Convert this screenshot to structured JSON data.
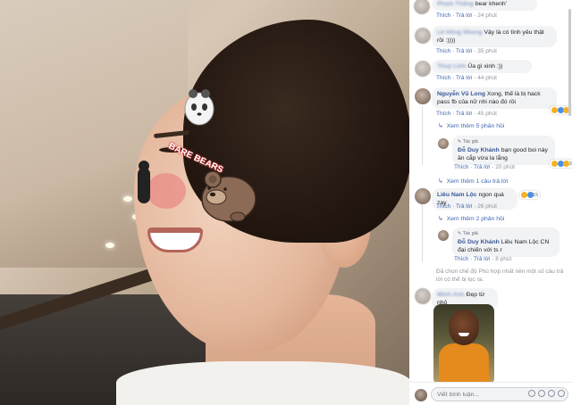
{
  "comments": [
    {
      "name": "Phạm Thắng",
      "text": "bear khenh'",
      "action_like": "Thích",
      "action_reply": "Trả lời",
      "time": "24 phút"
    },
    {
      "name": "Lê Hồng Nhung",
      "text": "Vậy là có tình yêu thật rồi :))))",
      "action_like": "Thích",
      "action_reply": "Trả lời",
      "time": "35 phút"
    },
    {
      "name": "Thuỳ Linh",
      "text": "Ủa gì xinh :))",
      "action_like": "Thích",
      "action_reply": "Trả lời",
      "time": "44 phút"
    },
    {
      "name": "Nguyễn Vũ Long",
      "text": "Xong, thế là bị hack pass fb của nữ nhi nào đó rồi",
      "action_like": "Thích",
      "action_reply": "Trả lời",
      "time": "45 phút",
      "reaction_count": "199",
      "more_replies": "Xem thêm 5 phản hồi"
    },
    {
      "author_tag": "Tác giả",
      "name": "Đỗ Duy Khánh",
      "text": "bạn good boi này ăn cắp vừa la lắng",
      "action_like": "Thích",
      "action_reply": "Trả lời",
      "time": "20 phút",
      "reaction_count": "30",
      "more_replies": "Xem thêm 1 câu trả lời"
    },
    {
      "name": "Liêu Nam Lộc",
      "text": "ngon quá zay",
      "action_like": "Thích",
      "action_reply": "Trả lời",
      "time": "26 phút",
      "reaction_count": "15",
      "more_replies": "Xem thêm 2 phản hồi"
    },
    {
      "author_tag": "Tác giả",
      "name": "Đỗ Duy Khánh",
      "text": "Liêu Nam Lộc CN đại chiến với ts r",
      "action_like": "Thích",
      "action_reply": "Trả lời",
      "time": "8 phút"
    },
    {
      "name": "Minh Anh",
      "text": "Đẹp từ nhỏ"
    }
  ],
  "filter_note": "Đã chọn chế độ Phù hợp nhất nên một số câu trả lời có thể bị lọc ra.",
  "input": {
    "placeholder": "Viết bình luận..."
  },
  "photo": {
    "sticker_text": "BARE BEARS"
  },
  "colors": {
    "name": "#385898",
    "link": "#4267b2",
    "bubble": "#f2f3f5"
  }
}
